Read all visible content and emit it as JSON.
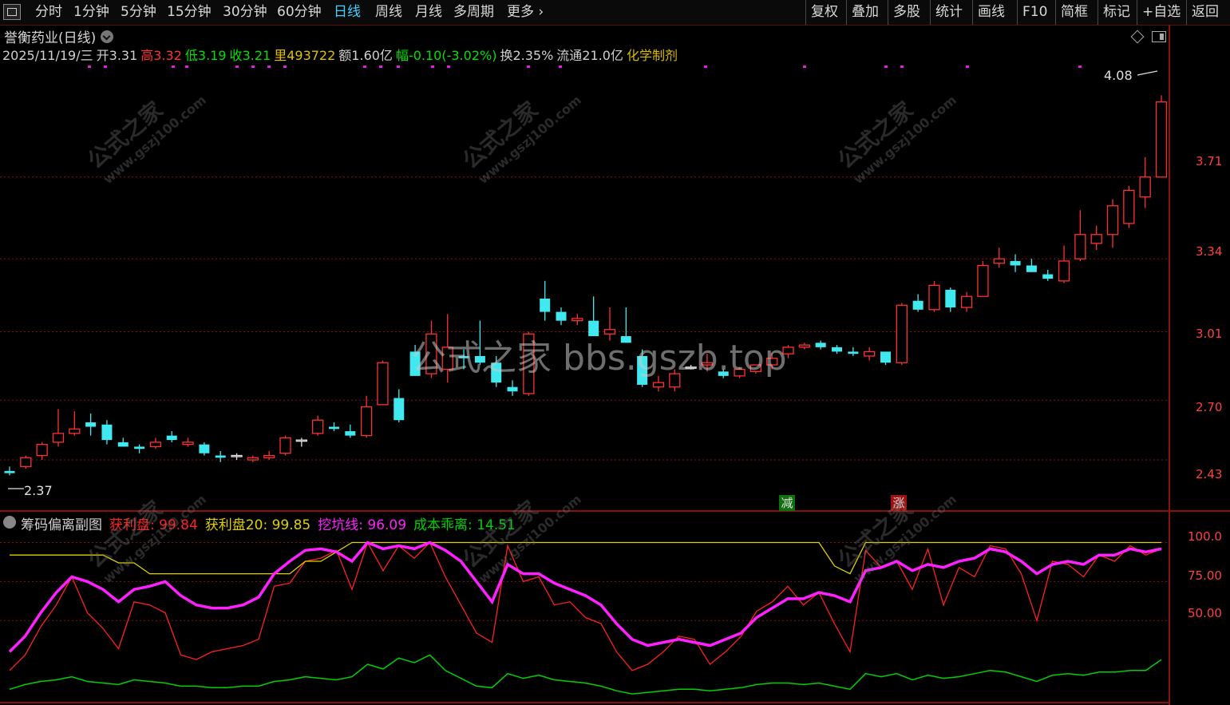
{
  "toolbar": {
    "left_items": [
      "分时",
      "1分钟",
      "5分钟",
      "15分钟",
      "30分钟",
      "60分钟",
      "日线",
      "周线",
      "月线",
      "多周期",
      "更多"
    ],
    "active_item": "日线",
    "right_items": [
      "复权",
      "叠加",
      "多股",
      "统计",
      "画线",
      "F10",
      "简框",
      "标记",
      "+自选",
      "返回"
    ]
  },
  "title": {
    "stock_name": "誉衡药业",
    "period": "(日线)"
  },
  "info": {
    "date": "2025/11/19/三",
    "open_label": "开",
    "open": "3.31",
    "high_label": "高",
    "high": "3.32",
    "low_label": "低",
    "low": "3.19",
    "close_label": "收",
    "close": "3.21",
    "volume_label": "里",
    "volume": "493722",
    "amount_label": "额",
    "amount": "1.60亿",
    "change_label": "幅",
    "change": "-0.10(-3.02%)",
    "turnover_label": "换",
    "turnover": "2.35%",
    "float_label": "流通",
    "float_cap": "21.0亿",
    "sector": "化学制剂"
  },
  "price_axis": [
    "3.71",
    "3.34",
    "3.01",
    "2.70",
    "2.43"
  ],
  "price_markers": {
    "max": "4.08",
    "min": "2.37"
  },
  "signal_markers": {
    "reduce": "减",
    "rise": "涨"
  },
  "indicator": {
    "name": "筹码偏离副图",
    "items": [
      {
        "label": "获利盘:",
        "value": "99.84",
        "color": "#ff2020"
      },
      {
        "label": "获利盘20:",
        "value": "99.85",
        "color": "#e0d000"
      },
      {
        "label": "挖坑线:",
        "value": "96.09",
        "color": "#ff20ff"
      },
      {
        "label": "成本乖离:",
        "value": "14.51",
        "color": "#00d000"
      }
    ],
    "axis": [
      "100.0",
      "75.00",
      "50.00"
    ]
  },
  "watermark": {
    "text": "公式之家 bbs.gszb.top",
    "diag_cn": "公式之家",
    "diag_url": "www.gszj100.com"
  },
  "colors": {
    "up": "#ff3030",
    "down": "#40e8f0",
    "grid": "#8a1010",
    "bg": "#000000"
  },
  "chart_data": {
    "type": "candlestick",
    "price_ylim": [
      2.3,
      4.15
    ],
    "candles": [
      [
        2.38,
        2.4,
        2.36,
        2.37
      ],
      [
        2.4,
        2.45,
        2.39,
        2.44
      ],
      [
        2.45,
        2.51,
        2.43,
        2.5
      ],
      [
        2.51,
        2.66,
        2.49,
        2.55
      ],
      [
        2.55,
        2.65,
        2.54,
        2.57
      ],
      [
        2.6,
        2.64,
        2.54,
        2.58
      ],
      [
        2.59,
        2.61,
        2.5,
        2.52
      ],
      [
        2.51,
        2.53,
        2.49,
        2.49
      ],
      [
        2.49,
        2.5,
        2.46,
        2.48
      ],
      [
        2.49,
        2.53,
        2.48,
        2.51
      ],
      [
        2.54,
        2.56,
        2.51,
        2.52
      ],
      [
        2.5,
        2.53,
        2.49,
        2.51
      ],
      [
        2.5,
        2.51,
        2.45,
        2.46
      ],
      [
        2.45,
        2.47,
        2.42,
        2.44
      ],
      [
        2.45,
        2.46,
        2.43,
        2.45
      ],
      [
        2.43,
        2.45,
        2.42,
        2.44
      ],
      [
        2.44,
        2.47,
        2.43,
        2.45
      ],
      [
        2.46,
        2.54,
        2.45,
        2.53
      ],
      [
        2.52,
        2.53,
        2.49,
        2.52
      ],
      [
        2.55,
        2.63,
        2.54,
        2.61
      ],
      [
        2.58,
        2.6,
        2.56,
        2.57
      ],
      [
        2.56,
        2.59,
        2.53,
        2.54
      ],
      [
        2.54,
        2.72,
        2.53,
        2.67
      ],
      [
        2.68,
        2.88,
        2.68,
        2.87
      ],
      [
        2.71,
        2.75,
        2.6,
        2.61
      ],
      [
        2.92,
        2.95,
        2.87,
        2.81
      ],
      [
        2.82,
        3.06,
        2.8,
        3.0
      ],
      [
        2.84,
        3.09,
        2.78,
        2.94
      ],
      [
        2.9,
        2.93,
        2.84,
        2.89
      ],
      [
        2.9,
        3.06,
        2.86,
        2.87
      ],
      [
        2.87,
        2.9,
        2.76,
        2.78
      ],
      [
        2.76,
        2.79,
        2.72,
        2.74
      ],
      [
        2.73,
        3.01,
        2.72,
        3.0
      ],
      [
        3.16,
        3.24,
        3.06,
        3.1
      ],
      [
        3.1,
        3.12,
        3.04,
        3.06
      ],
      [
        3.06,
        3.09,
        3.04,
        3.07
      ],
      [
        3.06,
        3.17,
        3.02,
        2.99
      ],
      [
        3.0,
        3.12,
        2.97,
        3.02
      ],
      [
        2.99,
        3.12,
        2.96,
        2.96
      ],
      [
        2.9,
        2.93,
        2.76,
        2.77
      ],
      [
        2.76,
        2.81,
        2.74,
        2.78
      ],
      [
        2.76,
        2.84,
        2.74,
        2.82
      ],
      [
        2.85,
        2.86,
        2.84,
        2.85
      ],
      [
        2.86,
        2.91,
        2.83,
        2.87
      ],
      [
        2.83,
        2.84,
        2.8,
        2.81
      ],
      [
        2.81,
        2.85,
        2.8,
        2.84
      ],
      [
        2.83,
        2.86,
        2.82,
        2.86
      ],
      [
        2.86,
        2.91,
        2.84,
        2.89
      ],
      [
        2.91,
        2.95,
        2.89,
        2.94
      ],
      [
        2.94,
        2.96,
        2.93,
        2.95
      ],
      [
        2.96,
        2.97,
        2.93,
        2.94
      ],
      [
        2.94,
        2.95,
        2.91,
        2.92
      ],
      [
        2.92,
        2.94,
        2.9,
        2.91
      ],
      [
        2.9,
        2.94,
        2.88,
        2.92
      ],
      [
        2.92,
        2.9,
        2.86,
        2.87
      ],
      [
        2.87,
        3.14,
        2.86,
        3.13
      ],
      [
        3.15,
        3.18,
        3.1,
        3.11
      ],
      [
        3.11,
        3.24,
        3.1,
        3.22
      ],
      [
        3.2,
        3.21,
        3.1,
        3.12
      ],
      [
        3.12,
        3.19,
        3.1,
        3.17
      ],
      [
        3.17,
        3.33,
        3.17,
        3.31
      ],
      [
        3.32,
        3.39,
        3.3,
        3.34
      ],
      [
        3.33,
        3.36,
        3.28,
        3.31
      ],
      [
        3.31,
        3.34,
        3.28,
        3.28
      ],
      [
        3.27,
        3.29,
        3.24,
        3.25
      ],
      [
        3.24,
        3.4,
        3.23,
        3.33
      ],
      [
        3.34,
        3.56,
        3.33,
        3.45
      ],
      [
        3.41,
        3.49,
        3.38,
        3.45
      ],
      [
        3.45,
        3.61,
        3.39,
        3.58
      ],
      [
        3.5,
        3.67,
        3.48,
        3.65
      ],
      [
        3.62,
        3.8,
        3.57,
        3.71
      ],
      [
        3.71,
        4.08,
        3.71,
        4.05
      ]
    ],
    "indicator_ylim": [
      0,
      110
    ],
    "series": [
      {
        "name": "获利盘",
        "values": [
          18,
          28,
          46,
          60,
          78,
          55,
          45,
          32,
          62,
          60,
          55,
          28,
          25,
          30,
          32,
          34,
          38,
          72,
          74,
          88,
          90,
          95,
          70,
          100,
          82,
          98,
          90,
          100,
          78,
          60,
          42,
          36,
          98,
          75,
          78,
          60,
          62,
          52,
          48,
          30,
          18,
          22,
          30,
          40,
          38,
          22,
          30,
          40,
          56,
          62,
          72,
          60,
          68,
          48,
          30,
          95,
          84,
          88,
          70,
          96,
          60,
          84,
          78,
          98,
          96,
          80,
          50,
          88,
          86,
          78,
          92,
          88,
          98,
          92,
          96
        ]
      },
      {
        "name": "获利盘20",
        "values": [
          92,
          92,
          92,
          92,
          92,
          92,
          92,
          87,
          87,
          80,
          80,
          80,
          80,
          80,
          80,
          80,
          80,
          80,
          80,
          88,
          88,
          94,
          100,
          100,
          100,
          100,
          100,
          100,
          100,
          100,
          100,
          100,
          100,
          100,
          100,
          100,
          100,
          100,
          100,
          100,
          100,
          100,
          100,
          100,
          100,
          100,
          100,
          100,
          100,
          100,
          100,
          100,
          100,
          85,
          80,
          100,
          100,
          100,
          100,
          100,
          100,
          100,
          100,
          100,
          100,
          100,
          100,
          100,
          100,
          100,
          100,
          100,
          100,
          100,
          100
        ]
      },
      {
        "name": "挖坑线",
        "values": [
          30,
          40,
          55,
          68,
          78,
          75,
          70,
          62,
          70,
          72,
          75,
          66,
          60,
          58,
          58,
          60,
          65,
          80,
          88,
          95,
          96,
          94,
          88,
          100,
          96,
          98,
          96,
          100,
          95,
          88,
          75,
          62,
          86,
          80,
          80,
          74,
          70,
          66,
          60,
          48,
          38,
          34,
          36,
          38,
          36,
          34,
          38,
          42,
          52,
          58,
          64,
          64,
          68,
          66,
          62,
          82,
          84,
          88,
          82,
          86,
          84,
          88,
          90,
          96,
          94,
          88,
          80,
          86,
          88,
          86,
          92,
          92,
          96,
          94,
          96
        ]
      },
      {
        "name": "成本乖离",
        "values": [
          6,
          9,
          11,
          12,
          14,
          11,
          10,
          9,
          12,
          11,
          10,
          8,
          8,
          7,
          7,
          8,
          8,
          11,
          12,
          14,
          13,
          12,
          14,
          22,
          19,
          26,
          23,
          28,
          18,
          13,
          8,
          7,
          16,
          13,
          15,
          12,
          11,
          10,
          8,
          5,
          3,
          4,
          5,
          6,
          6,
          5,
          6,
          7,
          9,
          10,
          10,
          9,
          10,
          8,
          6,
          16,
          14,
          16,
          12,
          15,
          13,
          14,
          16,
          18,
          17,
          14,
          11,
          15,
          16,
          15,
          17,
          17,
          18,
          18,
          25
        ]
      }
    ]
  }
}
